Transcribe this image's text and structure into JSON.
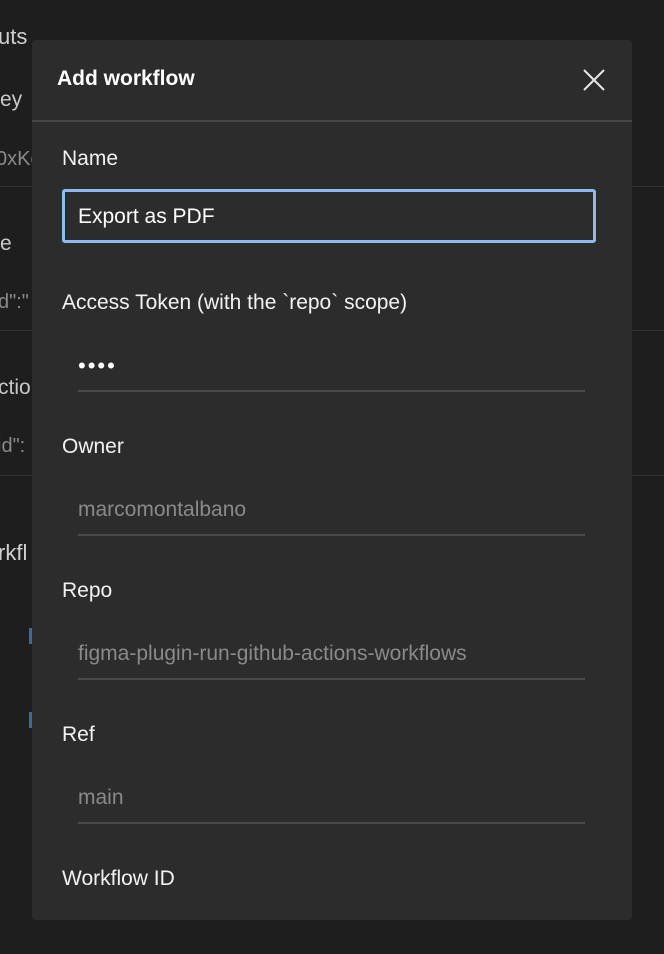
{
  "background": {
    "fragments": [
      "uts",
      "ey",
      "0xKe",
      "e",
      "d\":\"",
      "ctio",
      "id\":",
      "rkfl"
    ]
  },
  "modal": {
    "title": "Add workflow",
    "close_icon": "close-icon",
    "fields": {
      "name": {
        "label": "Name",
        "value": "Export as PDF"
      },
      "token": {
        "label": "Access Token (with the `repo` scope)",
        "value": "••••"
      },
      "owner": {
        "label": "Owner",
        "placeholder": "marcomontalbano"
      },
      "repo": {
        "label": "Repo",
        "placeholder": "figma-plugin-run-github-actions-workflows"
      },
      "ref": {
        "label": "Ref",
        "placeholder": "main"
      },
      "workflow_id": {
        "label": "Workflow ID"
      }
    }
  },
  "colors": {
    "accent": "#8bbcec",
    "modal_bg": "#2c2c2c",
    "page_bg": "#1e1e1e"
  }
}
